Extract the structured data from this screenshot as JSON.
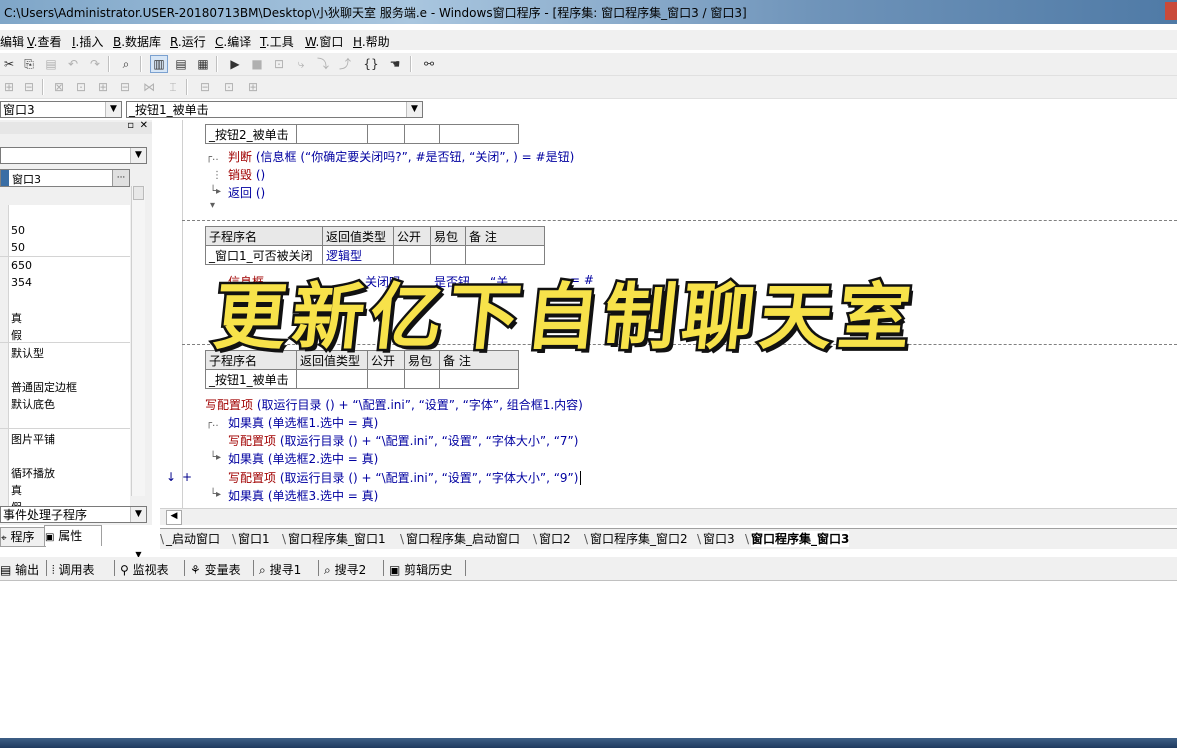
{
  "window": {
    "title": "C:\\Users\\Administrator.USER-20180713BM\\Desktop\\小狄聊天室 服务端.e - Windows窗口程序 - [程序集: 窗口程序集_窗口3 / 窗口3]"
  },
  "menubar": [
    {
      "key": "",
      "label": "编辑"
    },
    {
      "key": "V",
      "label": ".查看"
    },
    {
      "key": "I",
      "label": ".插入"
    },
    {
      "key": "B",
      "label": ".数据库"
    },
    {
      "key": "R",
      "label": ".运行"
    },
    {
      "key": "C",
      "label": ".编译"
    },
    {
      "key": "T",
      "label": ".工具"
    },
    {
      "key": "W",
      "label": ".窗口"
    },
    {
      "key": "H",
      "label": ".帮助"
    }
  ],
  "combos": {
    "left": "窗口3",
    "right": "_按钮1_被单击",
    "type": "窗口3"
  },
  "properties": [
    "",
    "50",
    "50",
    "650",
    "354",
    "",
    "真",
    "假",
    "默认型",
    "",
    "普通固定边框",
    "默认底色",
    "",
    "图片平铺",
    "",
    "循环播放",
    "真",
    "假"
  ],
  "panel": {
    "event_combo": "事件处理子程序",
    "tab_program": "程序",
    "tab_property": "属性"
  },
  "subroutine_header": [
    "子程序名",
    "返回值类型",
    "公开",
    "易包",
    "备 注"
  ],
  "block1": {
    "name": "_按钮2_被单击",
    "lines": [
      {
        "fn": "判断",
        "args": " (信息框 (“你确定要关闭吗?”, #是否钮, “关闭”, ) = #是钮)"
      },
      {
        "fn": "销毁",
        "args": " ()"
      },
      {
        "fn": "返回",
        "args": " ()"
      }
    ]
  },
  "block2": {
    "name": "_窗口1_可否被关闭",
    "ret": "逻辑型",
    "line_fn": "信息框",
    "line_mid": "关闭吗",
    "line_mid2": "是否钮",
    "line_tail": "“关",
    "line_tail2": "= #"
  },
  "block3": {
    "name": "_按钮1_被单击",
    "lines": [
      {
        "fn": "写配置项",
        "args": " (取运行目录 () + “\\配置.ini”, “设置”, “字体”, 组合框1.内容)"
      },
      {
        "fn": "如果真",
        "args": " (单选框1.选中 = 真)"
      },
      {
        "fn": "写配置项",
        "args": " (取运行目录 () + “\\配置.ini”, “设置”, “字体大小”, “7”)"
      },
      {
        "fn": "如果真",
        "args": " (单选框2.选中 = 真)"
      },
      {
        "fn": "写配置项",
        "args": " (取运行目录 () + “\\配置.ini”, “设置”, “字体大小”, “9”)"
      },
      {
        "fn": "如果真",
        "args": " (单选框3.选中 = 真)"
      }
    ]
  },
  "gutter_marks": [
    "↓",
    "+"
  ],
  "tabs": [
    "_启动窗口",
    "窗口1",
    "窗口程序集_窗口1",
    "窗口程序集_启动窗口",
    "窗口2",
    "窗口程序集_窗口2",
    "窗口3",
    "窗口程序集_窗口3"
  ],
  "output_tabs": [
    "输出",
    "调用表",
    "监视表",
    "变量表",
    "搜寻1",
    "搜寻2",
    "剪辑历史"
  ],
  "overlay_text": "更新亿下自制聊天室"
}
